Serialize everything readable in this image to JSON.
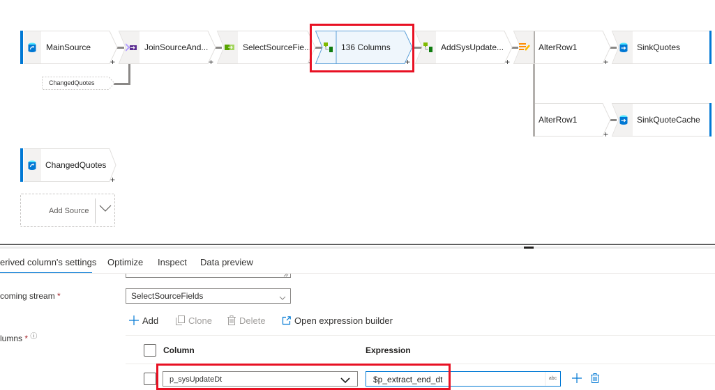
{
  "canvas": {
    "nodes": [
      {
        "id": "main-source",
        "label": "MainSource",
        "type": "source",
        "icon": "source-icon"
      },
      {
        "id": "join",
        "label": "JoinSourceAnd...",
        "type": "join",
        "icon": "join-icon"
      },
      {
        "id": "select-source-fields",
        "label": "SelectSourceFie...",
        "type": "select",
        "icon": "select-icon"
      },
      {
        "id": "derived-136",
        "label": "136 Columns",
        "type": "derived-column",
        "icon": "derived-column-icon",
        "selected": true
      },
      {
        "id": "add-sys-update",
        "label": "AddSysUpdate...",
        "type": "derived-column",
        "icon": "derived-column-icon"
      },
      {
        "id": "alter-row-1",
        "label": "AlterRow1",
        "type": "alter-row",
        "icon": "alter-row-icon"
      },
      {
        "id": "sink-quotes",
        "label": "SinkQuotes",
        "type": "sink",
        "icon": "sink-icon"
      },
      {
        "id": "alter-row-1-branch",
        "label": "AlterRow1",
        "type": "branch"
      },
      {
        "id": "sink-quote-cache",
        "label": "SinkQuoteCache",
        "type": "sink",
        "icon": "sink-icon"
      },
      {
        "id": "changed-quotes",
        "label": "ChangedQuotes",
        "type": "source",
        "icon": "source-icon"
      }
    ],
    "join_reference": "ChangedQuotes",
    "add_source_label": "Add Source",
    "plus": "+"
  },
  "tabs": [
    {
      "label": "Derived column's settings",
      "visible_label": "erived column's settings",
      "active": true
    },
    {
      "label": "Optimize",
      "active": false
    },
    {
      "label": "Inspect",
      "active": false
    },
    {
      "label": "Data preview",
      "active": false
    }
  ],
  "settings": {
    "incoming_stream_label": "coming stream",
    "incoming_stream_value": "SelectSourceFields",
    "columns_label": "lumns",
    "required_mark": "*",
    "info_icon": "ⓘ",
    "toolbar": {
      "add": "Add",
      "clone": "Clone",
      "delete": "Delete",
      "open_expression_builder": "Open expression builder"
    },
    "table": {
      "headers": [
        "Column",
        "Expression"
      ],
      "rows": [
        {
          "column": "p_sysUpdateDt",
          "expression": "$p_extract_end_dt",
          "type_badge": "abc"
        }
      ]
    }
  },
  "colors": {
    "accent": "#0078d4",
    "highlight": "#e81123",
    "selected_node_fill": "#eff6fc"
  }
}
